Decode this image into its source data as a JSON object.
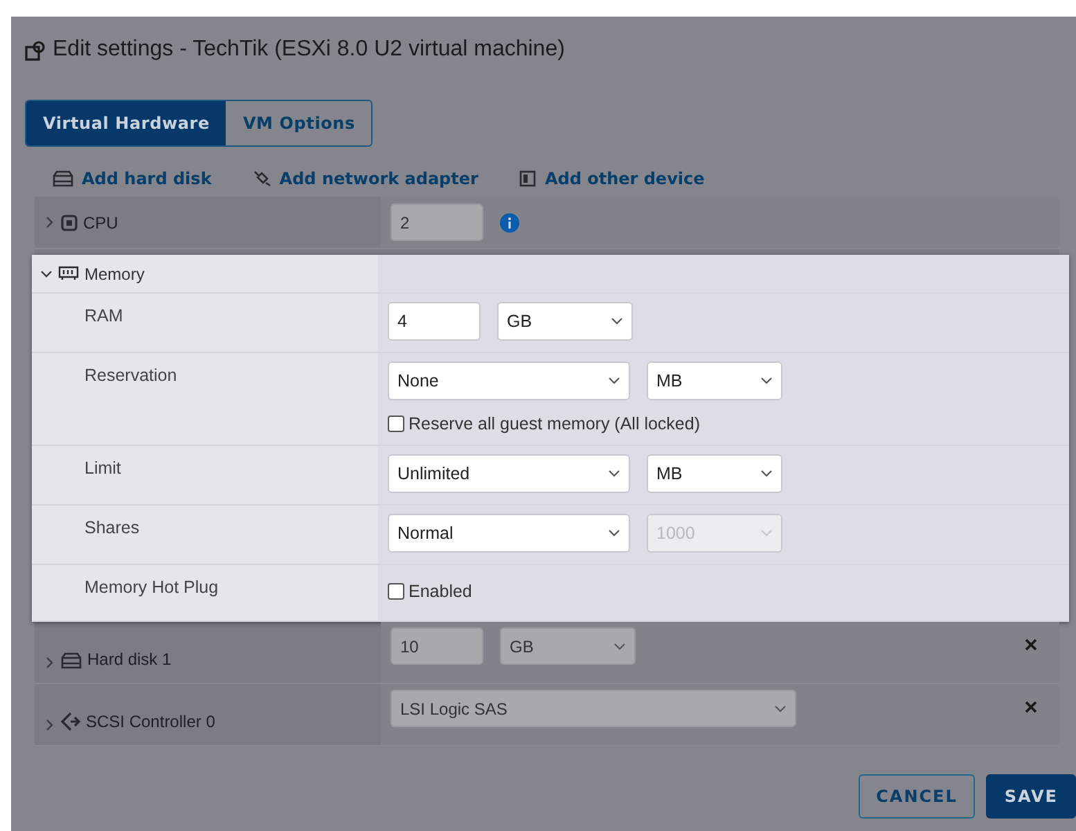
{
  "dialog": {
    "title": "Edit settings - TechTik (ESXi 8.0 U2 virtual machine)"
  },
  "tabs": [
    {
      "label": "Virtual Hardware",
      "selected": true
    },
    {
      "label": "VM Options",
      "selected": false
    }
  ],
  "toolbar": [
    {
      "label": "Add hard disk",
      "kind": "disk"
    },
    {
      "label": "Add network adapter",
      "kind": "network"
    },
    {
      "label": "Add other device",
      "kind": "device"
    }
  ],
  "cpu": {
    "name": "CPU",
    "expanded": false,
    "value": "2"
  },
  "memory": {
    "name": "Memory",
    "expanded": true,
    "rows": [
      {
        "label": "RAM",
        "fields": [
          {
            "kind": "number",
            "value": "4",
            "disabled": false
          },
          {
            "kind": "unit",
            "value": "GB",
            "disabled": false
          }
        ]
      },
      {
        "label": "Reservation",
        "fields": [
          {
            "kind": "select",
            "value": "None",
            "disabled": false
          },
          {
            "kind": "unit",
            "value": "MB",
            "disabled": false
          }
        ],
        "checkbox": {
          "label": "Reserve all guest memory (All locked)",
          "checked": false
        }
      },
      {
        "label": "Limit",
        "fields": [
          {
            "kind": "select",
            "value": "Unlimited",
            "disabled": false
          },
          {
            "kind": "unit",
            "value": "MB",
            "disabled": false
          }
        ]
      },
      {
        "label": "Shares",
        "fields": [
          {
            "kind": "select",
            "value": "Normal",
            "disabled": false
          },
          {
            "kind": "unit",
            "value": "1000",
            "disabled": true
          }
        ]
      },
      {
        "label": "Memory Hot Plug",
        "fields": [],
        "checkbox": {
          "label": "Enabled",
          "checked": false
        }
      }
    ]
  },
  "devices": [
    {
      "kind": "disk",
      "name": "Hard disk 1",
      "expanded": false,
      "removable": true,
      "fields": [
        {
          "kind": "number",
          "value": "10"
        },
        {
          "kind": "unit",
          "value": "GB"
        }
      ]
    },
    {
      "kind": "controller",
      "name": "SCSI Controller 0",
      "expanded": false,
      "removable": true,
      "fields": [
        {
          "kind": "long",
          "value": "LSI Logic SAS"
        }
      ]
    }
  ],
  "buttons": [
    {
      "label": "CANCEL",
      "kind": "secondary"
    },
    {
      "label": "SAVE",
      "kind": "primary"
    }
  ]
}
